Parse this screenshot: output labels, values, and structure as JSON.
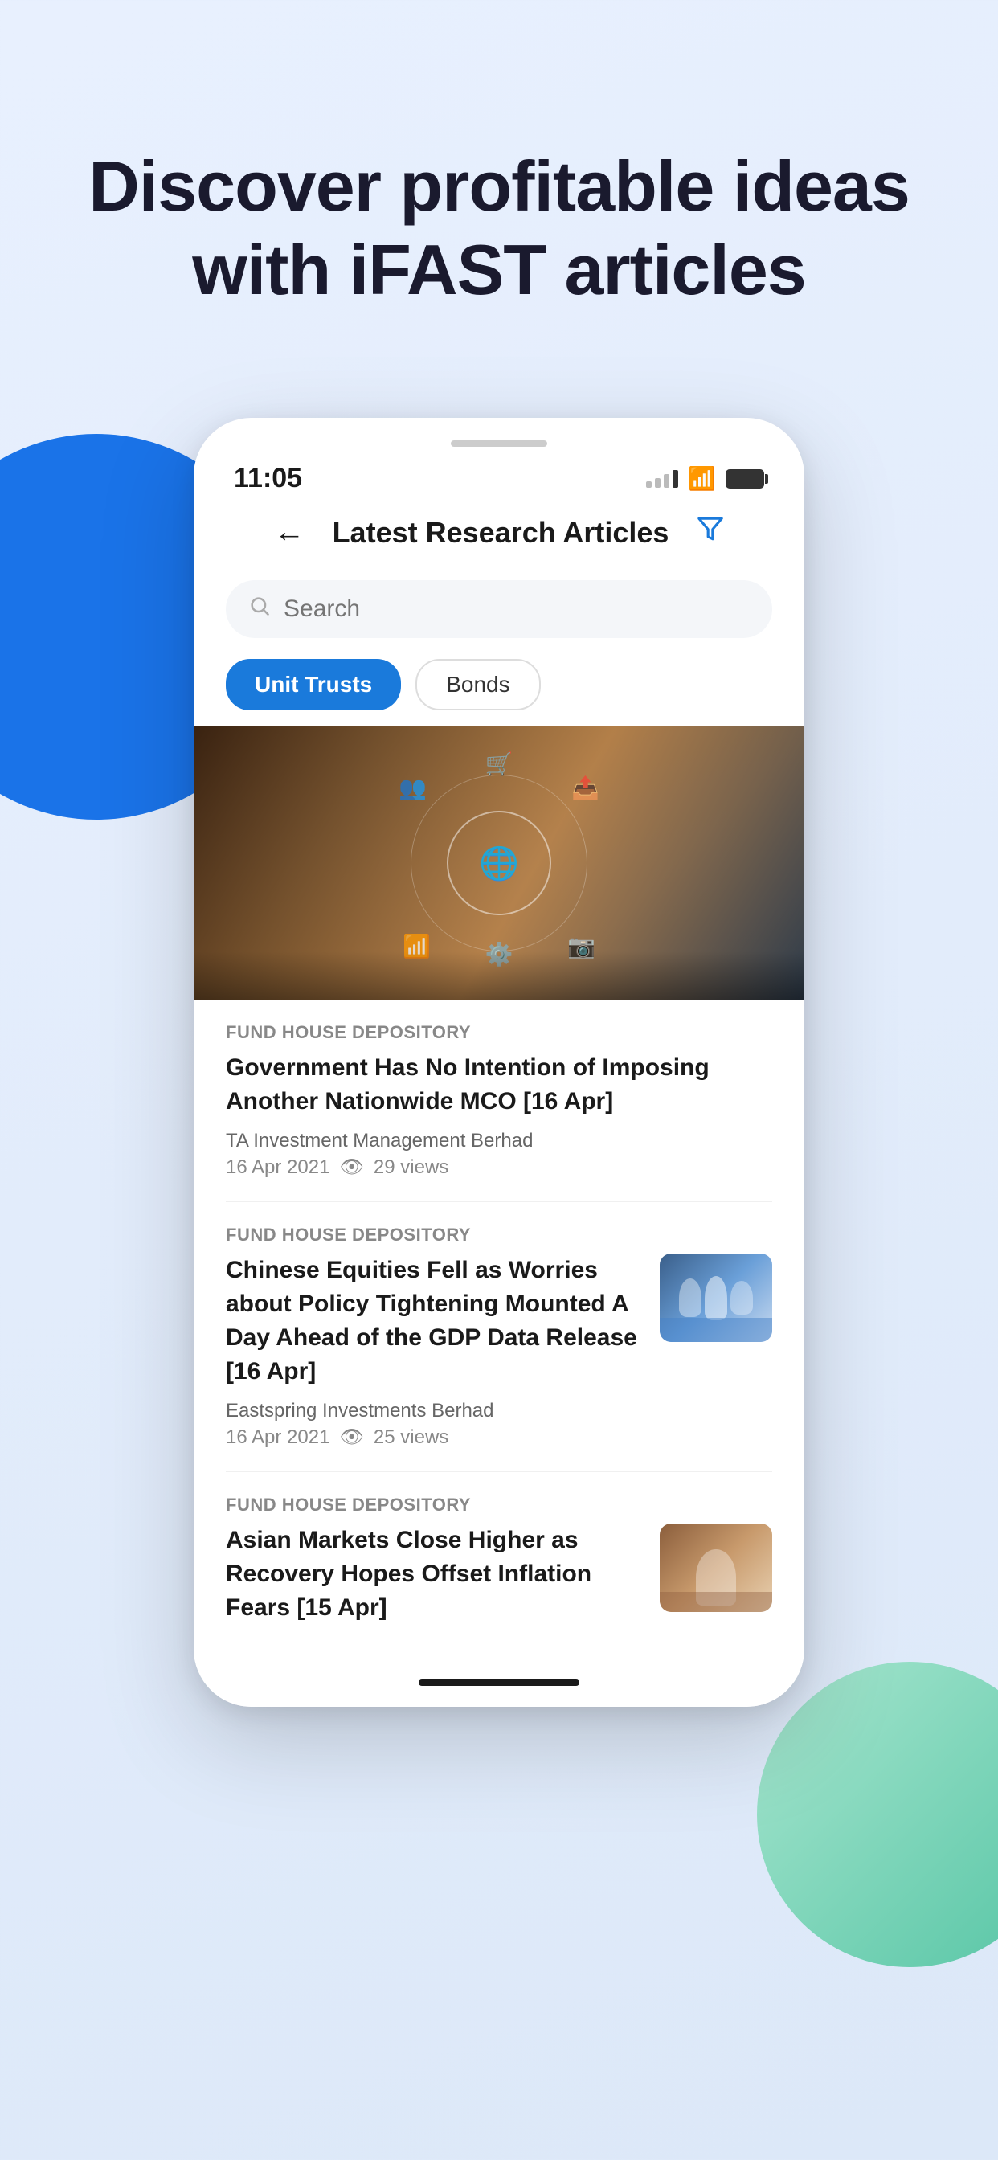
{
  "background": {
    "color": "#e8f0fe"
  },
  "hero": {
    "title": "Discover profitable ideas with iFAST articles"
  },
  "phone": {
    "status_bar": {
      "time": "11:05",
      "signal": "signal",
      "wifi": "wifi",
      "battery": "battery"
    },
    "nav": {
      "title": "Latest Research Articles",
      "back_label": "←",
      "filter_label": "⧩"
    },
    "search": {
      "placeholder": "Search"
    },
    "tabs": [
      {
        "label": "Unit Trusts",
        "active": true
      },
      {
        "label": "Bonds",
        "active": false
      }
    ],
    "articles": [
      {
        "id": "1",
        "category": "FUND HOUSE DEPOSITORY",
        "title": "Government Has No Intention of Imposing Another Nationwide MCO [16 Apr]",
        "author": "TA Investment Management Berhad",
        "date": "16 Apr 2021",
        "views": "29 views",
        "has_thumb": false
      },
      {
        "id": "2",
        "category": "FUND HOUSE DEPOSITORY",
        "title": "Chinese Equities Fell as Worries about Policy Tightening Mounted A Day Ahead of the GDP Data Release [16 Apr]",
        "author": "Eastspring Investments Berhad",
        "date": "16 Apr 2021",
        "views": "25 views",
        "has_thumb": true,
        "thumb_type": "meeting"
      },
      {
        "id": "3",
        "category": "FUND HOUSE DEPOSITORY",
        "title": "Asian Markets Close Higher as Recovery Hopes Offset Inflation Fears [15 Apr]",
        "author": "",
        "date": "",
        "views": "",
        "has_thumb": true,
        "thumb_type": "office"
      }
    ]
  }
}
